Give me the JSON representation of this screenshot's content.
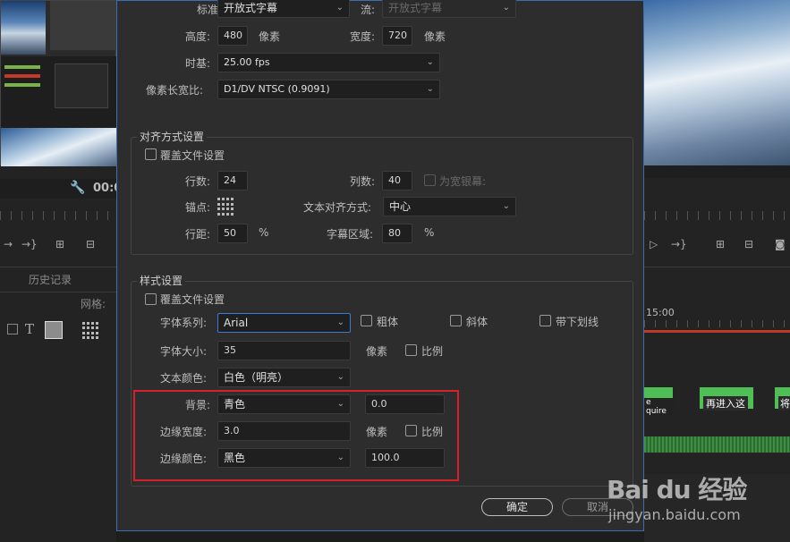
{
  "dialog": {
    "top_rows": {
      "standard_label": "标准:",
      "standard_value": "开放式字幕",
      "stream_label": "流:",
      "stream_value": "开放式字幕",
      "height_label": "高度:",
      "height_value": "480",
      "height_unit": "像素",
      "width_label": "宽度:",
      "width_value": "720",
      "width_unit": "像素",
      "timebase_label": "时基:",
      "timebase_value": "25.00 fps",
      "pixel_aspect_label": "像素长宽比:",
      "pixel_aspect_value": "D1/DV NTSC (0.9091)"
    },
    "alignment": {
      "title": "对齐方式设置",
      "override_label": "覆盖文件设置",
      "rows_label": "行数:",
      "rows_value": "24",
      "cols_label": "列数:",
      "cols_value": "40",
      "widescreen_label": "为宽银幕:",
      "anchor_label": "锚点:",
      "text_align_label": "文本对齐方式:",
      "text_align_value": "中心",
      "line_spacing_label": "行距:",
      "line_spacing_value": "50",
      "line_spacing_unit": "%",
      "caption_area_label": "字幕区域:",
      "caption_area_value": "80",
      "caption_area_unit": "%"
    },
    "style": {
      "title": "样式设置",
      "override_label": "覆盖文件设置",
      "font_family_label": "字体系列:",
      "font_family_value": "Arial",
      "bold_label": "粗体",
      "italic_label": "斜体",
      "underline_label": "带下划线",
      "font_size_label": "字体大小:",
      "font_size_value": "35",
      "font_size_unit": "像素",
      "font_size_scale_label": "比例",
      "text_color_label": "文本颜色:",
      "text_color_value": "白色（明亮）",
      "bg_label": "背景:",
      "bg_value": "青色",
      "bg_opacity_value": "0.0",
      "edge_width_label": "边缘宽度:",
      "edge_width_value": "3.0",
      "edge_width_unit": "像素",
      "edge_scale_label": "比例",
      "edge_color_label": "边缘颜色:",
      "edge_color_value": "黑色",
      "edge_opacity_value": "100.0"
    },
    "buttons": {
      "ok": "确定",
      "cancel": "取消"
    }
  },
  "background": {
    "history_tab": "历史记录",
    "grid_label": "网格:",
    "timecode": "00:0",
    "ruler_time": "15:00",
    "clip1": "e quire",
    "clip2": "再进入这",
    "clip3": "将"
  },
  "watermark": {
    "brand": "Bai du 经验",
    "url": "jingyan.baidu.com"
  },
  "colors": {
    "highlight_box": "#d8202c",
    "dialog_border": "#3a6fb5",
    "clip_green": "#4fbf55"
  }
}
